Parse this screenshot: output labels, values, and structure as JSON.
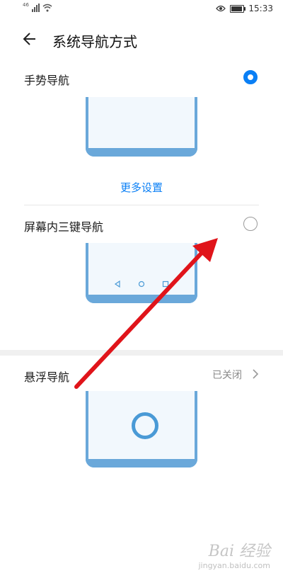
{
  "status_bar": {
    "time": "15:33",
    "signal_text": "46"
  },
  "header": {
    "title": "系统导航方式"
  },
  "options": [
    {
      "label": "手势导航",
      "selected": true
    },
    {
      "label": "屏幕内三键导航",
      "selected": false
    },
    {
      "label": "悬浮导航",
      "status": "已关闭"
    }
  ],
  "more_settings": "更多设置",
  "watermark": {
    "main": "Bai 经验",
    "sub": "jingyan.baidu.com"
  },
  "colors": {
    "accent": "#0a7ff5",
    "phone_frame": "#6aa8da",
    "annotation_arrow": "#e0141a"
  }
}
